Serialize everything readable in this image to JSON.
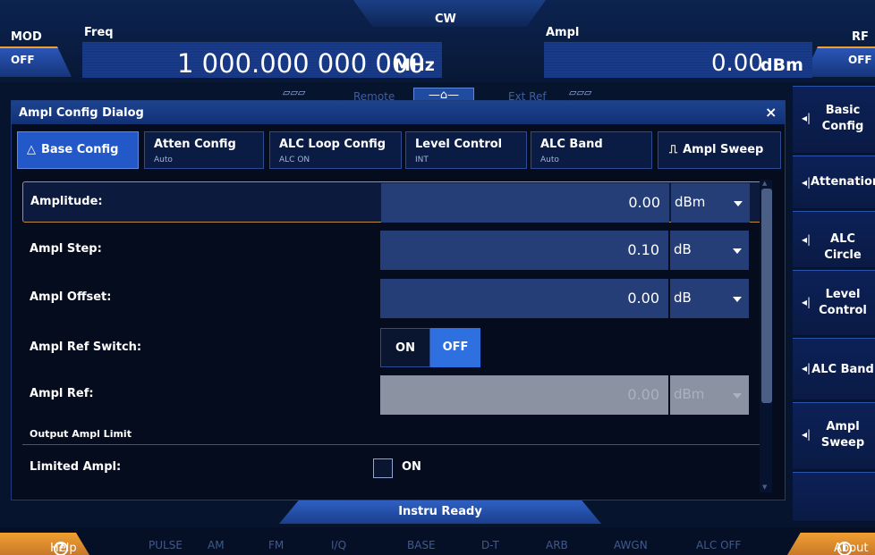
{
  "top": {
    "mod_label": "MOD",
    "mod_state": "OFF",
    "rf_label": "RF",
    "rf_state": "OFF",
    "mode": "CW",
    "freq_label": "Freq",
    "freq_value": "1 000.000 000 000",
    "freq_unit": "MHz",
    "ampl_label": "Ampl",
    "ampl_value": "0.00",
    "ampl_unit": "dBm",
    "remote": "Remote",
    "ext_ref": "Ext Ref",
    "home": "—⌂—"
  },
  "dialog": {
    "title": "Ampl Config Dialog",
    "close": "×",
    "tabs": [
      {
        "label": "Base Config",
        "sub": ""
      },
      {
        "label": "Atten Config",
        "sub": "Auto"
      },
      {
        "label": "ALC Loop Config",
        "sub": "ALC ON"
      },
      {
        "label": "Level Control",
        "sub": "INT"
      },
      {
        "label": "ALC Band",
        "sub": "Auto"
      },
      {
        "label": "Ampl Sweep",
        "sub": ""
      }
    ],
    "rows": {
      "amplitude": {
        "label": "Amplitude:",
        "value": "0.00",
        "unit": "dBm"
      },
      "step": {
        "label": "Ampl Step:",
        "value": "0.10",
        "unit": "dB"
      },
      "offset": {
        "label": "Ampl Offset:",
        "value": "0.00",
        "unit": "dB"
      },
      "ref_switch": {
        "label": "Ampl Ref Switch:",
        "on": "ON",
        "off": "OFF"
      },
      "ref": {
        "label": "Ampl Ref:",
        "value": "0.00",
        "unit": "dBm"
      },
      "section": "Output Ampl Limit",
      "limited": {
        "label": "Limited Ampl:",
        "check_label": "ON"
      }
    }
  },
  "right_panel": [
    {
      "label": "Basic Config"
    },
    {
      "label": "Attenation"
    },
    {
      "label": "ALC Circle"
    },
    {
      "label": "Level Control"
    },
    {
      "label": "ALC Band"
    },
    {
      "label": "Ampl Sweep"
    }
  ],
  "bottom": {
    "ready": "Instru Ready",
    "help": "Help",
    "about": "About",
    "indicators": [
      "PULSE",
      "AM",
      "FM",
      "I/Q",
      "BASE",
      "D-T",
      "ARB",
      "AWGN",
      "ALC OFF"
    ]
  }
}
